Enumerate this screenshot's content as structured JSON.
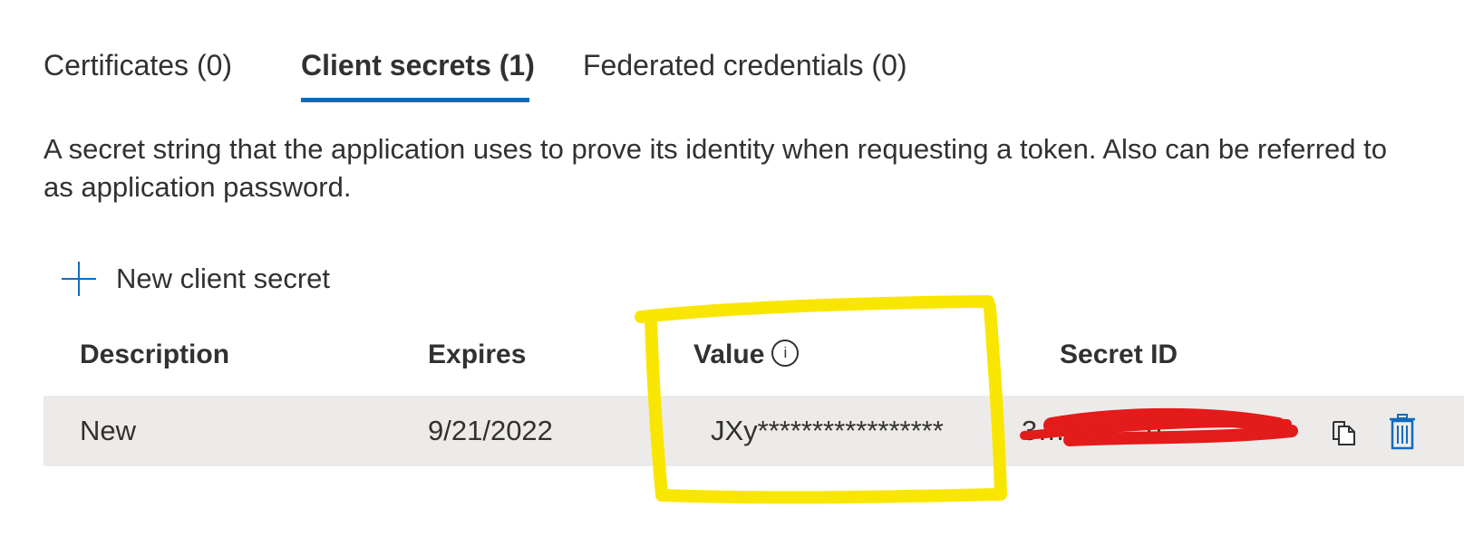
{
  "tabs": [
    {
      "label": "Certificates (0)",
      "active": false
    },
    {
      "label": "Client secrets (1)",
      "active": true
    },
    {
      "label": "Federated credentials (0)",
      "active": false
    }
  ],
  "description_line1": "A secret string that the application uses to prove its identity when requesting a token. Also can be referred to",
  "description_line2": "as application password.",
  "new_secret_label": "New client secret",
  "table": {
    "headers": [
      "Description",
      "Expires",
      "Value",
      "Secret ID"
    ],
    "rows": [
      {
        "description": "New",
        "expires": "9/21/2022",
        "value": "JXy*****************",
        "secret_id": "3…b…-…d…"
      }
    ]
  },
  "colors": {
    "accent": "#0f6cbd",
    "row_background": "#edebe9",
    "highlight": "#f9e600",
    "redaction": "#e31b1b"
  },
  "icons": [
    "plus-icon",
    "info-icon",
    "copy-icon",
    "delete-icon"
  ]
}
